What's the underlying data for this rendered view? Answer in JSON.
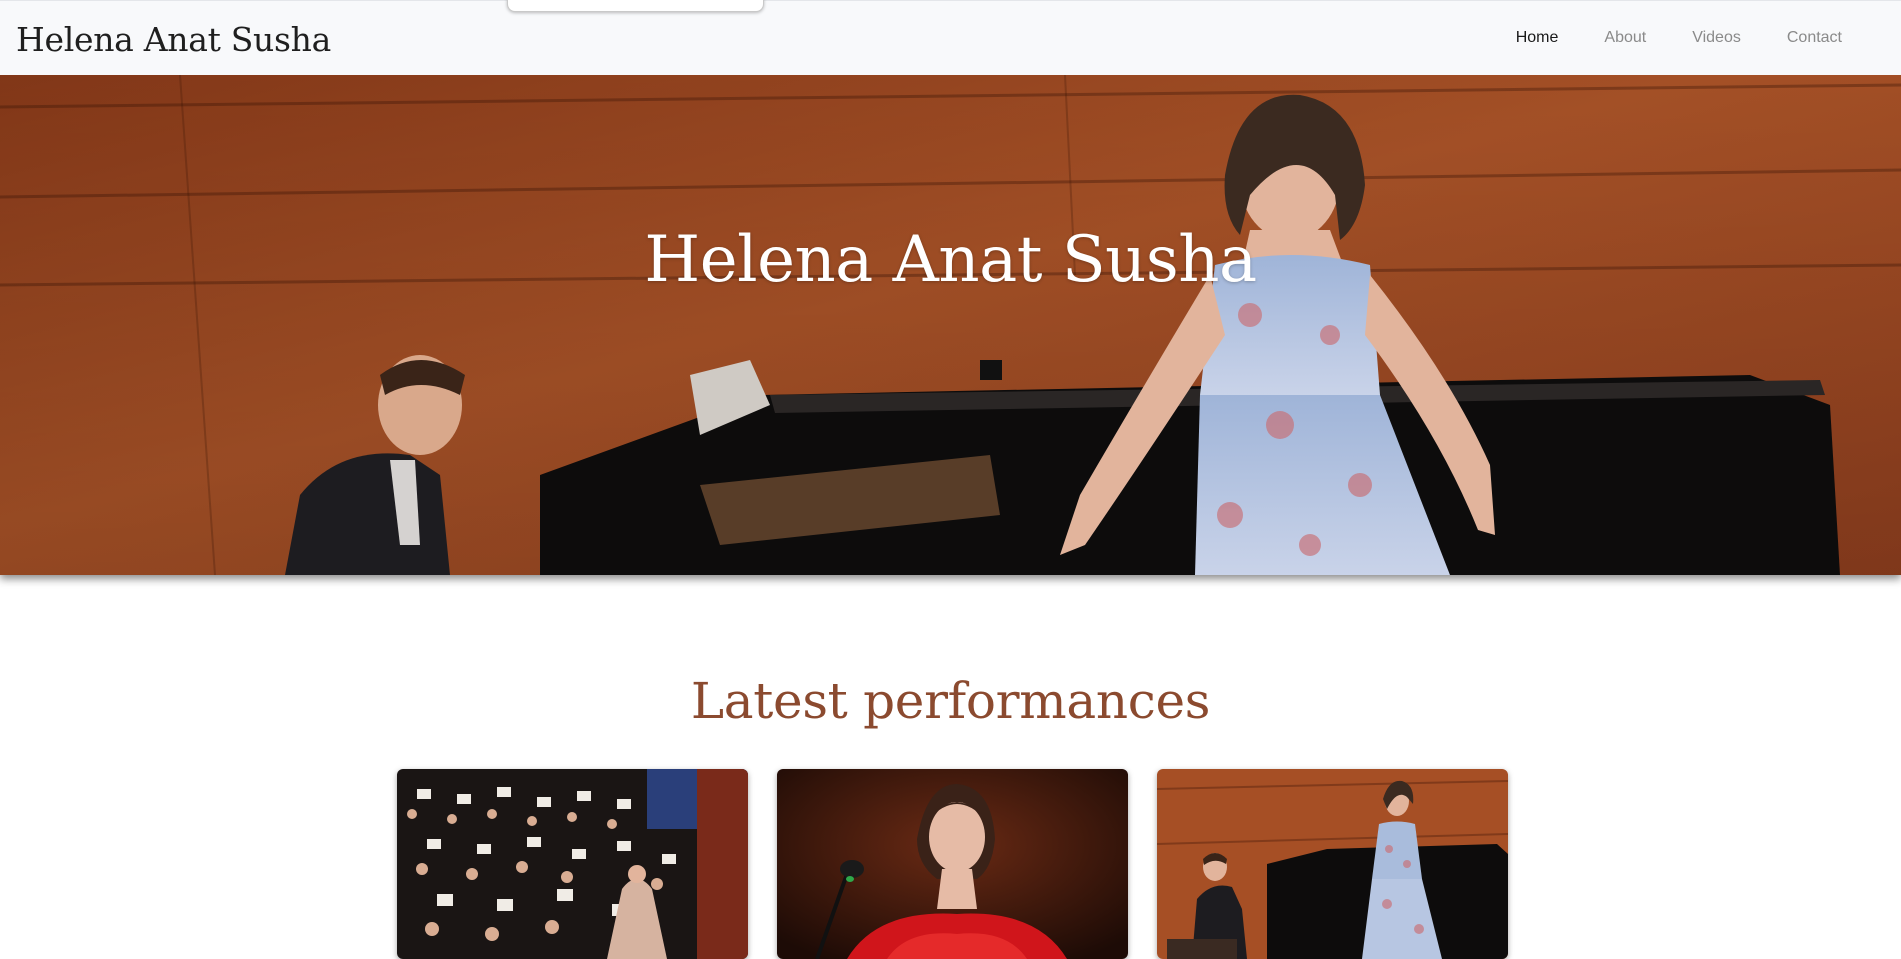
{
  "navbar": {
    "brand": "Helena Anat Susha",
    "links": [
      {
        "label": "Home",
        "active": true
      },
      {
        "label": "About",
        "active": false
      },
      {
        "label": "Videos",
        "active": false
      },
      {
        "label": "Contact",
        "active": false
      }
    ]
  },
  "hero": {
    "title": "Helena Anat Susha"
  },
  "performances": {
    "heading": "Latest performances"
  },
  "colors": {
    "accent": "#8b4a2f",
    "navbar_bg": "#f8f9fb",
    "hero_wood": "#a34a22"
  }
}
